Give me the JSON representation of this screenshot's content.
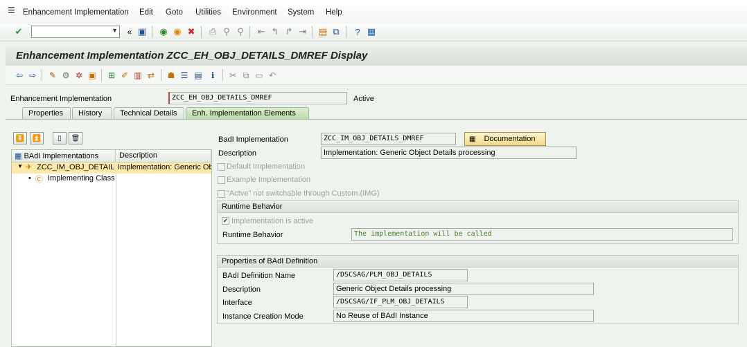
{
  "menubar": {
    "items": [
      "Enhancement Implementation",
      "Edit",
      "Goto",
      "Utilities",
      "Environment",
      "System",
      "Help"
    ]
  },
  "toolbar": {
    "command_value": "",
    "icons": [
      "enter-icon",
      "save-icon",
      "back-icon",
      "exit-icon",
      "cancel-icon",
      "print-icon",
      "find-icon",
      "find-next-icon",
      "first-page-icon",
      "prev-page-icon",
      "next-page-icon",
      "last-page-icon",
      "new-session-icon",
      "shortcut-icon",
      "help-icon",
      "layout-icon"
    ]
  },
  "title": "Enhancement Implementation ZCC_EH_OBJ_DETAILS_DMREF Display",
  "header": {
    "label": "Enhancement Implementation",
    "value": "ZCC_EH_OBJ_DETAILS_DMREF",
    "status": "Active"
  },
  "tabs": [
    {
      "label": "Properties",
      "active": false
    },
    {
      "label": "History",
      "active": false
    },
    {
      "label": "Technical Details",
      "active": false
    },
    {
      "label": "Enh. Implementation Elements",
      "active": true
    }
  ],
  "tree": {
    "col1": "BAdI Implementations",
    "col2": "Description",
    "row1_name": "ZCC_IM_OBJ_DETAILS",
    "row1_desc": "Implementation: Generic Ob",
    "row2_name": "Implementing Class"
  },
  "detail": {
    "badi_impl_label": "BadI Implementation",
    "badi_impl_value": "ZCC_IM_OBJ_DETAILS_DMREF",
    "documentation_btn": "Documentation",
    "description_label": "Description",
    "description_value": "Implementation: Generic Object Details processing",
    "default_impl": "Default Implementation",
    "example_impl": "Example Implementation",
    "not_switchable": "\"Actve\" not switchable through Custom.(IMG)"
  },
  "runtime": {
    "title": "Runtime Behavior",
    "active_label": "Implementation is active",
    "active_checked": true,
    "behavior_label": "Runtime Behavior",
    "behavior_value": "The implementation will be called"
  },
  "props": {
    "title": "Properties of BAdI Definition",
    "def_name_label": "BAdI Definition Name",
    "def_name_value": "/DSCSAG/PLM_OBJ_DETAILS",
    "desc_label": "Description",
    "desc_value": "Generic Object Details processing",
    "interface_label": "Interface",
    "interface_value": "/DSCSAG/IF_PLM_OBJ_DETAILS",
    "instance_label": "Instance Creation Mode",
    "instance_value": "No Reuse of BAdI Instance"
  },
  "colors": {
    "selected_row": "#ffe9a8",
    "active_tab": "#b8d9a0",
    "doc_button": "#f2d98a"
  }
}
